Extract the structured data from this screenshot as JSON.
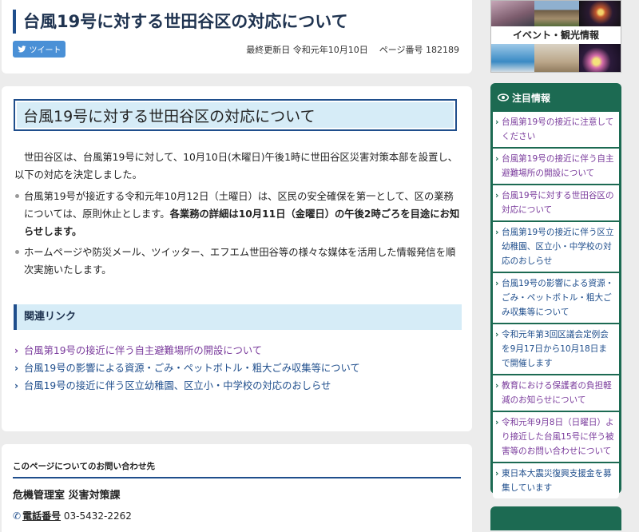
{
  "header": {
    "title": "台風19号に対する世田谷区の対応について",
    "tweet_label": "ツイート",
    "last_updated": "最終更新日 令和元年10月10日",
    "page_number": "ページ番号 182189"
  },
  "article": {
    "heading": "台風19号に対する世田谷区の対応について",
    "intro": "世田谷区は、台風第19号に対して、10月10日(木曜日)午後1時に世田谷区災害対策本部を設置し、以下の対応を決定しました。",
    "bullet1_text": "台風第19号が接近する令和元年10月12日（土曜日）は、区民の安全確保を第一として、区の業務については、原則休止とします。",
    "bullet1_bold": "各業務の詳細は10月11日（金曜日）の午後2時ごろを目途にお知らせします。",
    "bullet2_text": "ホームページや防災メール、ツイッター、エフエム世田谷等の様々な媒体を活用した情報発信を順次実施いたします。"
  },
  "related": {
    "heading": "関連リンク",
    "links": [
      "台風第19号の接近に伴う自主避難場所の開設について",
      "台風19号の影響による資源・ごみ・ペットボトル・粗大ごみ収集等について",
      "台風19号の接近に伴う区立幼稚園、区立小・中学校の対応のおしらせ"
    ]
  },
  "contact": {
    "title": "このページについてのお問い合わせ先",
    "department": "危機管理室 災害対策課",
    "phone_label": "電話番号",
    "phone_number": "03-5432-2262"
  },
  "sidebar": {
    "banner_label": "イベント・観光情報",
    "notice_heading": "注目情報",
    "notice_items": [
      "台風第19号の接近に注意してください",
      "台風第19号の接近に伴う自主避難場所の開設について",
      "台風19号に対する世田谷区の対応について",
      "台風第19号の接近に伴う区立幼稚園、区立小・中学校の対応のおしらせ",
      "台風19号の影響による資源・ごみ・ペットボトル・粗大ごみ収集等について",
      "令和元年第3回区議会定例会を9月17日から10月18日まで開催します",
      "教育における保護者の負担軽減のお知らせについて",
      "令和元年9月8日（日曜日）より接近した台風15号に伴う被害等のお問い合わせについて",
      "東日本大震災復興支援金を募集しています"
    ]
  },
  "colors": {
    "accent_navy": "#1f4e8c",
    "sidebar_green": "#1c6a52",
    "link_purple": "#7a3b9c",
    "heading_bg": "#d6ecf7"
  },
  "icons": [
    "twitter-bird-icon",
    "phone-icon",
    "eye-icon",
    "chevron-right-icon"
  ]
}
